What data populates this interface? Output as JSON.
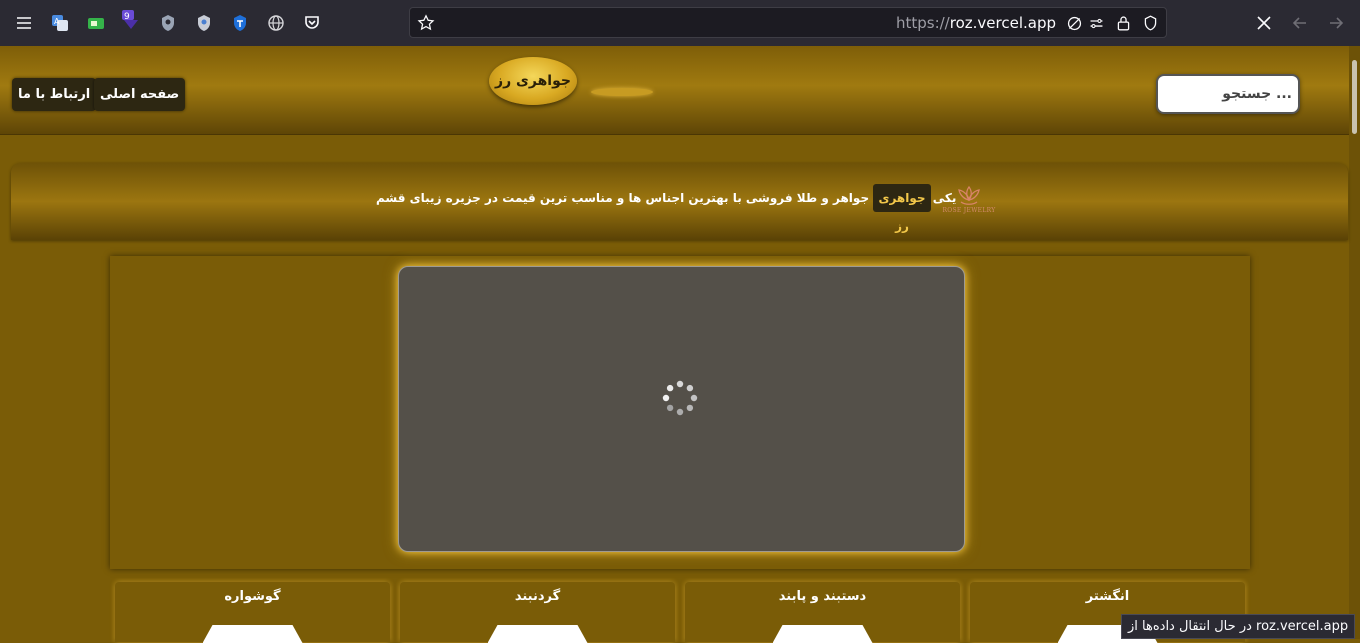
{
  "browser": {
    "url_protocol": "https://",
    "url_host": "roz.vercel.app",
    "extension_badge": "9",
    "status_text": "در حال انتقال داده‌ها از roz.vercel.app"
  },
  "header": {
    "contact_label": "ارتباط با ما",
    "home_label": "صفحه اصلی",
    "logo_text": "جواهری رز",
    "search_placeholder": "جستجو ..."
  },
  "banner": {
    "brand": "جواهری رز",
    "text": "یکی از بهترین جواهر و طلا فروشی با بهترین اجناس ها و مناسب ترین قیمت در جزیره زیبای قشم",
    "logo_caption": "ROSE JEWELRY"
  },
  "categories": [
    {
      "title": "گوشواره"
    },
    {
      "title": "گردنبند"
    },
    {
      "title": "دستبند و پابند"
    },
    {
      "title": "انگشتر"
    }
  ],
  "colors": {
    "page_bg": "#7a5c07",
    "accent_gold": "#f0c23b",
    "dark_button": "#2d2712"
  }
}
